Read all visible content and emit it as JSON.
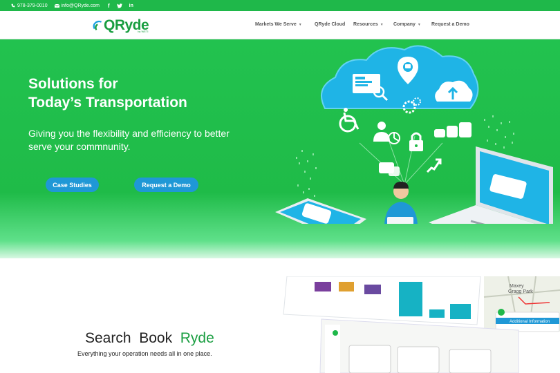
{
  "topbar": {
    "phone": "978-379-0010",
    "email": "info@QRyde.com",
    "social": [
      "facebook-icon",
      "twitter-icon",
      "linkedin-icon"
    ]
  },
  "logo": {
    "name": "QRyde",
    "tagline": "by WETI"
  },
  "nav": {
    "items": [
      {
        "label": "Markets We Serve",
        "dropdown": true
      },
      {
        "label": "QRyde Cloud",
        "dropdown": false
      },
      {
        "label": "Resources",
        "dropdown": true
      },
      {
        "label": "Company",
        "dropdown": true
      },
      {
        "label": "Request a Demo",
        "dropdown": false
      }
    ]
  },
  "hero": {
    "title_line1": "Solutions for",
    "title_line2": "Today’s Transportation",
    "subtitle_line1": "Giving you the flexibility and efficiency to better",
    "subtitle_line2": "serve your commnunity.",
    "case_studies_label": "Case Studies",
    "request_demo_label": "Request a Demo"
  },
  "section": {
    "word1": "Search",
    "word2": "Book",
    "word3": "Ryde",
    "subtitle": "Everything your operation needs all in one place."
  },
  "preview": {
    "map_label1": "Maxey",
    "map_label2": "Gragg Park",
    "additional_info": "Additional Information"
  },
  "colors": {
    "brand_green": "#1fb84a",
    "button_blue": "#1f98d6",
    "text_dark": "#222222"
  }
}
